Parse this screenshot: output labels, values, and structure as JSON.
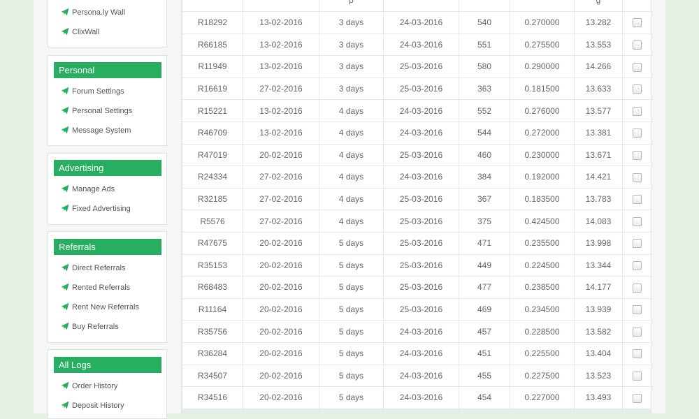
{
  "sidebar": {
    "top_items": [
      {
        "label": "Persona.ly Wall",
        "icon": "send-icon"
      },
      {
        "label": "ClixWall",
        "icon": "send-icon"
      }
    ],
    "sections": [
      {
        "title": "Personal",
        "items": [
          "Forum Settings",
          "Personal Settings",
          "Message System"
        ]
      },
      {
        "title": "Advertising",
        "items": [
          "Manage Ads",
          "Fixed Advertising"
        ]
      },
      {
        "title": "Referrals",
        "items": [
          "Direct Referrals",
          "Rented Referrals",
          "Rent New Referrals",
          "Buy Referrals"
        ]
      },
      {
        "title": "All Logs",
        "items": [
          "Order History",
          "Deposit History"
        ]
      }
    ]
  },
  "table": {
    "headers": [
      "",
      "",
      "p",
      "",
      "",
      "",
      "g",
      ""
    ],
    "rows": [
      [
        "R18292",
        "13-02-2016",
        "3 days",
        "24-03-2016",
        "540",
        "0.270000",
        "13.282"
      ],
      [
        "R66185",
        "13-02-2016",
        "3 days",
        "24-03-2016",
        "551",
        "0.275500",
        "13.553"
      ],
      [
        "R11949",
        "13-02-2016",
        "3 days",
        "25-03-2016",
        "580",
        "0.290000",
        "14.266"
      ],
      [
        "R16619",
        "27-02-2016",
        "3 days",
        "25-03-2016",
        "363",
        "0.181500",
        "13.633"
      ],
      [
        "R15221",
        "13-02-2016",
        "4 days",
        "24-03-2016",
        "552",
        "0.276000",
        "13.577"
      ],
      [
        "R46709",
        "13-02-2016",
        "4 days",
        "24-03-2016",
        "544",
        "0.272000",
        "13.381"
      ],
      [
        "R47019",
        "20-02-2016",
        "4 days",
        "25-03-2016",
        "460",
        "0.230000",
        "13.671"
      ],
      [
        "R24334",
        "27-02-2016",
        "4 days",
        "24-03-2016",
        "384",
        "0.192000",
        "14.421"
      ],
      [
        "R32185",
        "27-02-2016",
        "4 days",
        "25-03-2016",
        "367",
        "0.183500",
        "13.783"
      ],
      [
        "R5576",
        "27-02-2016",
        "4 days",
        "25-03-2016",
        "375",
        "0.424500",
        "14.083"
      ],
      [
        "R47675",
        "20-02-2016",
        "5 days",
        "25-03-2016",
        "471",
        "0.235500",
        "13.998"
      ],
      [
        "R35153",
        "20-02-2016",
        "5 days",
        "25-03-2016",
        "449",
        "0.224500",
        "13.344"
      ],
      [
        "R68483",
        "20-02-2016",
        "5 days",
        "25-03-2016",
        "477",
        "0.238500",
        "14.177"
      ],
      [
        "R11164",
        "20-02-2016",
        "5 days",
        "25-03-2016",
        "469",
        "0.234500",
        "13.939"
      ],
      [
        "R35756",
        "20-02-2016",
        "5 days",
        "24-03-2016",
        "457",
        "0.228500",
        "13.582"
      ],
      [
        "R36284",
        "20-02-2016",
        "5 days",
        "24-03-2016",
        "451",
        "0.225500",
        "13.404"
      ],
      [
        "R34507",
        "20-02-2016",
        "5 days",
        "24-03-2016",
        "455",
        "0.227500",
        "13.523"
      ],
      [
        "R34516",
        "20-02-2016",
        "5 days",
        "24-03-2016",
        "454",
        "0.227000",
        "13.493"
      ]
    ]
  },
  "colors": {
    "accent": "#27ae60",
    "page_bg": "#e6f0e3"
  }
}
